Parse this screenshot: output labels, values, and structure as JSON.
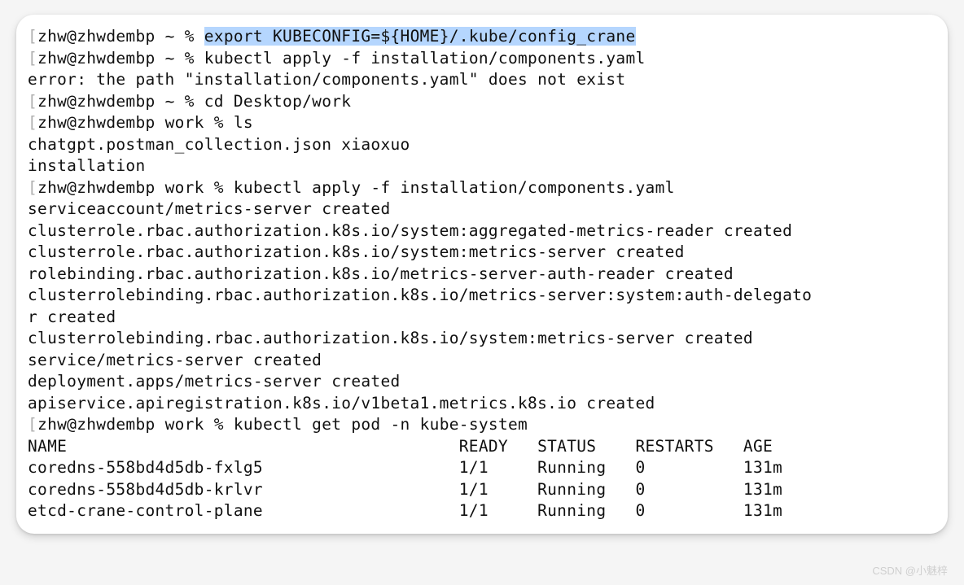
{
  "prompts": {
    "homeBracket": "[",
    "homePrompt": "zhw@zhwdembp ~ % ",
    "workPrompt": "zhw@zhwdembp work % "
  },
  "lines": {
    "l0_cmd_pre": "",
    "l0_cmd_hl": "export KUBECONFIG=${HOME}/.kube/config_crane",
    "l1_cmd": "kubectl apply -f installation/components.yaml",
    "l2": "error: the path \"installation/components.yaml\" does not exist",
    "l3_cmd": "cd Desktop/work",
    "l4_cmd": "ls",
    "l5": "chatgpt.postman_collection.json xiaoxuo",
    "l6": "installation",
    "l7_cmd": "kubectl apply -f installation/components.yaml",
    "l8": "serviceaccount/metrics-server created",
    "l9": "clusterrole.rbac.authorization.k8s.io/system:aggregated-metrics-reader created",
    "l10": "clusterrole.rbac.authorization.k8s.io/system:metrics-server created",
    "l11": "rolebinding.rbac.authorization.k8s.io/metrics-server-auth-reader created",
    "l12": "clusterrolebinding.rbac.authorization.k8s.io/metrics-server:system:auth-delegato",
    "l13": "r created",
    "l14": "clusterrolebinding.rbac.authorization.k8s.io/system:metrics-server created",
    "l15": "service/metrics-server created",
    "l16": "deployment.apps/metrics-server created",
    "l17": "apiservice.apiregistration.k8s.io/v1beta1.metrics.k8s.io created",
    "l18_cmd": "kubectl get pod -n kube-system"
  },
  "table": {
    "header": {
      "name": "NAME",
      "ready": "READY",
      "status": "STATUS",
      "restarts": "RESTARTS",
      "age": "AGE"
    },
    "rows": [
      {
        "name": "coredns-558bd4d5db-fxlg5",
        "ready": "1/1",
        "status": "Running",
        "restarts": "0",
        "age": "131m"
      },
      {
        "name": "coredns-558bd4d5db-krlvr",
        "ready": "1/1",
        "status": "Running",
        "restarts": "0",
        "age": "131m"
      },
      {
        "name": "etcd-crane-control-plane",
        "ready": "1/1",
        "status": "Running",
        "restarts": "0",
        "age": "131m"
      }
    ]
  },
  "watermark": "CSDN @小魅梓"
}
